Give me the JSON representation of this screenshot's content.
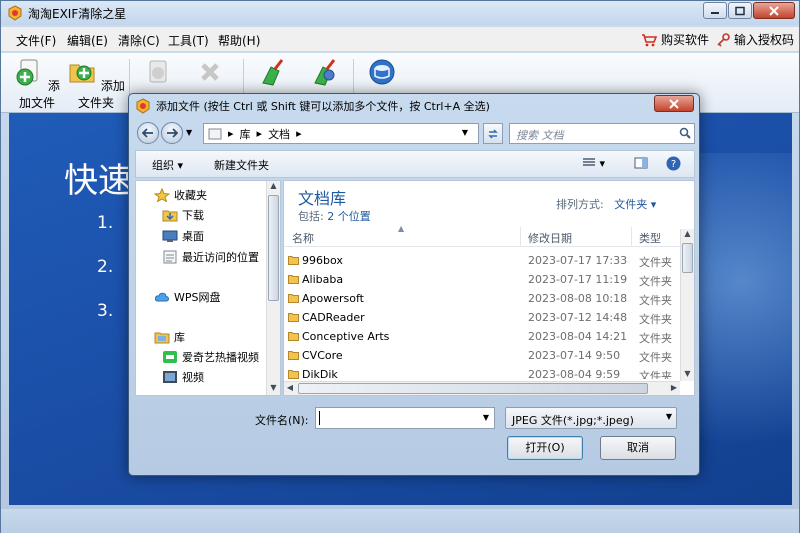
{
  "app": {
    "title": "淘淘EXIF清除之星",
    "colors": {
      "accent_blue": "#1b4fa8",
      "title_bar": "#c3d6ec",
      "close_red": "#c2442b"
    }
  },
  "menu": {
    "items": [
      "文件(F)",
      "编辑(E)",
      "清除(C)",
      "工具(T)",
      "帮助(H)"
    ],
    "buy": "购买软件",
    "license": "输入授权码"
  },
  "toolbar": {
    "add_file": "添加文件",
    "add_folder": "添加文件夹",
    "icons": [
      "add-file-icon",
      "add-folder-icon",
      "remove-icon",
      "delete-icon",
      "clean-icon",
      "settings-icon",
      "database-icon"
    ]
  },
  "content": {
    "title": "快速",
    "steps": [
      "1.",
      "2.",
      "3."
    ]
  },
  "dialog": {
    "title": "添加文件 (按住 Ctrl 或 Shift 键可以添加多个文件，按 Ctrl+A 全选)",
    "path": [
      "库",
      "文档"
    ],
    "search_placeholder": "搜索 文档",
    "organize": "组织",
    "new_folder": "新建文件夹",
    "nav_items": [
      {
        "label": "收藏夹"
      },
      {
        "label": "下载"
      },
      {
        "label": "桌面"
      },
      {
        "label": "最近访问的位置"
      },
      {
        "label": "WPS网盘"
      },
      {
        "label": "库"
      },
      {
        "label": "爱奇艺热播视频"
      },
      {
        "label": "视频"
      }
    ],
    "library_title": "文档库",
    "library_sub": "包括:",
    "library_locations": "2 个位置",
    "arrange_label": "排列方式:",
    "arrange_value": "文件夹",
    "columns": [
      "名称",
      "修改日期",
      "类型"
    ],
    "files": [
      {
        "name": "996box",
        "date": "2023-07-17 17:33",
        "type": "文件夹"
      },
      {
        "name": "Alibaba",
        "date": "2023-07-17 11:19",
        "type": "文件夹"
      },
      {
        "name": "Apowersoft",
        "date": "2023-08-08 10:18",
        "type": "文件夹"
      },
      {
        "name": "CADReader",
        "date": "2023-07-12 14:48",
        "type": "文件夹"
      },
      {
        "name": "Conceptive Arts",
        "date": "2023-08-04 14:21",
        "type": "文件夹"
      },
      {
        "name": "CVCore",
        "date": "2023-07-14 9:50",
        "type": "文件夹"
      },
      {
        "name": "DikDik",
        "date": "2023-08-04 9:59",
        "type": "文件夹"
      }
    ],
    "filename_label": "文件名(N):",
    "filename_value": "",
    "filter": "JPEG 文件(*.jpg;*.jpeg)",
    "open": "打开(O)",
    "cancel": "取消"
  }
}
